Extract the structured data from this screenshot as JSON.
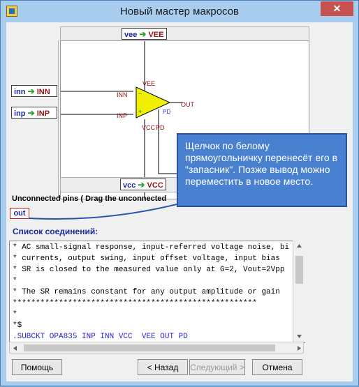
{
  "window": {
    "title": "Новый мастер макросов"
  },
  "pins": {
    "top": {
      "net": "vee",
      "pin": "VEE"
    },
    "left": [
      {
        "net": "inn",
        "pin": "INN"
      },
      {
        "net": "inp",
        "pin": "INP"
      }
    ],
    "bottom": {
      "net": "vcc",
      "pin": "VCC"
    }
  },
  "symbol": {
    "labels": {
      "vee": "VEE",
      "inn": "INN",
      "inp": "INP",
      "out": "OUT",
      "pd": "PD",
      "vcc": "VCC",
      "pd2": "PD"
    }
  },
  "unconnected": {
    "label": "Unconnected pins ( Drag the unconnected",
    "pins": [
      "out"
    ]
  },
  "netlist": {
    "label": "Список соединений:",
    "lines": [
      "* AC small-signal response, input-referred voltage noise, bi",
      "* currents, output swing, input offset voltage, input bias",
      "* SR is closed to the measured value only at G=2, Vout=2Vpp",
      "*",
      "* The SR remains constant for any output amplitude or gain",
      "*****************************************************",
      "*",
      "*$",
      ".SUBCKT OPA835 INP INN VCC  VEE OUT PD"
    ]
  },
  "buttons": {
    "help": "Помощь",
    "back": "< Назад",
    "next": "Следующий >",
    "cancel": "Отмена"
  },
  "tooltip": "Щелчок по белому прямоугольничку перенесёт его в \"запасник\". Позже вывод можно переместить в новое место."
}
